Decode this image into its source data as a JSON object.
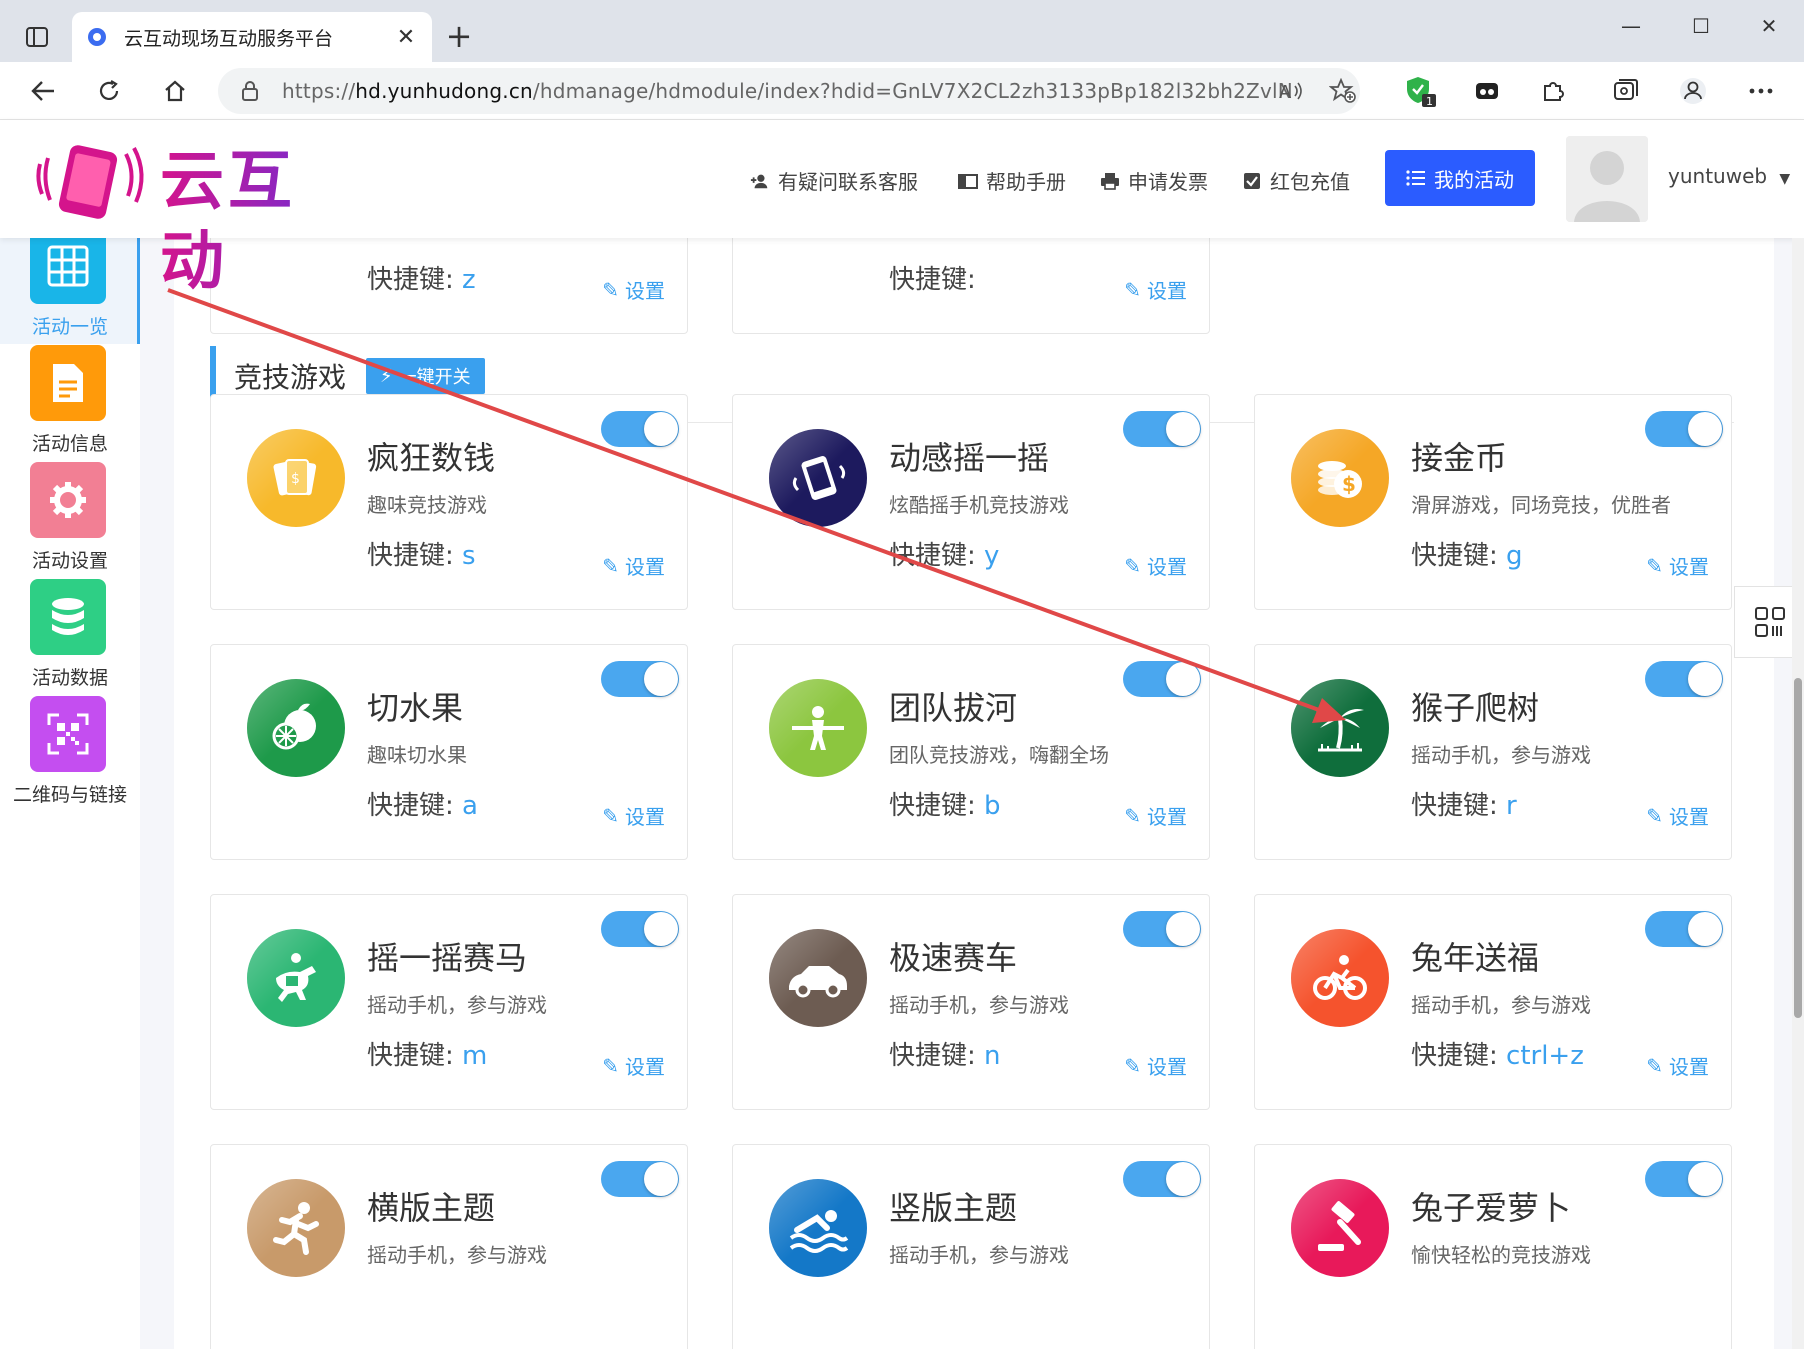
{
  "browser": {
    "tab_title": "云互动现场互动服务平台",
    "url_prefix": "https://",
    "url_host": "hd.yunhudong.cn",
    "url_path": "/hdmanage/hdmodule/index?hdid=GnLV7X2CL2zh3133pBp182l32bh2ZvlN",
    "extension_badge": "1"
  },
  "header": {
    "logo_text": "云互动",
    "links": {
      "support": "有疑问联系客服",
      "manual": "帮助手册",
      "invoice": "申请发票",
      "recharge": "红包充值"
    },
    "my_activity": "我的活动",
    "username": "yuntuweb"
  },
  "sidebar": {
    "items": [
      {
        "label": "活动一览",
        "color": "#19b5e8"
      },
      {
        "label": "活动信息",
        "color": "#ff9a0a"
      },
      {
        "label": "活动设置",
        "color": "#f27f94"
      },
      {
        "label": "活动数据",
        "color": "#2ecf85"
      },
      {
        "label": "二维码与链接",
        "color": "#c44ef0"
      }
    ]
  },
  "top_partial": {
    "key_label": "快捷键:",
    "card1_key": "z",
    "card2_key": "",
    "set_label": "设置"
  },
  "section": {
    "title": "竞技游戏",
    "one_key": "一键开关"
  },
  "labels": {
    "key": "快捷键:",
    "set": "设置"
  },
  "games": [
    {
      "title": "疯狂数钱",
      "desc": "趣味竞技游戏",
      "key": "s",
      "color": "#f7b92b",
      "icon": "money-cards-icon",
      "enabled": true
    },
    {
      "title": "动感摇一摇",
      "desc": "炫酷摇手机竞技游戏",
      "key": "y",
      "color": "#1d1a5e",
      "icon": "shake-phone-icon",
      "enabled": true
    },
    {
      "title": "接金币",
      "desc": "滑屏游戏，同场竞技，优胜者",
      "key": "g",
      "color": "#f5a726",
      "icon": "coins-icon",
      "enabled": true
    },
    {
      "title": "切水果",
      "desc": "趣味切水果",
      "key": "a",
      "color": "#1e9a4a",
      "icon": "fruit-icon",
      "enabled": true
    },
    {
      "title": "团队拔河",
      "desc": "团队竞技游戏，嗨翻全场",
      "key": "b",
      "color": "#8cc63f",
      "icon": "tug-of-war-icon",
      "enabled": true
    },
    {
      "title": "猴子爬树",
      "desc": "摇动手机，参与游戏",
      "key": "r",
      "color": "#0f6e3c",
      "icon": "palm-tree-icon",
      "enabled": true
    },
    {
      "title": "摇一摇赛马",
      "desc": "摇动手机，参与游戏",
      "key": "m",
      "color": "#2bb673",
      "icon": "horse-racing-icon",
      "enabled": true
    },
    {
      "title": "极速赛车",
      "desc": "摇动手机，参与游戏",
      "key": "n",
      "color": "#6d5c52",
      "icon": "car-icon",
      "enabled": true
    },
    {
      "title": "兔年送福",
      "desc": "摇动手机，参与游戏",
      "key": "ctrl+z",
      "color": "#f5532d",
      "icon": "bicycle-icon",
      "enabled": true
    },
    {
      "title": "横版主题",
      "desc": "摇动手机，参与游戏",
      "key": "",
      "color": "#c89a6a",
      "icon": "runner-icon",
      "enabled": true
    },
    {
      "title": "竖版主题",
      "desc": "摇动手机，参与游戏",
      "key": "",
      "color": "#1478c8",
      "icon": "swimmer-icon",
      "enabled": true
    },
    {
      "title": "兔子爱萝卜",
      "desc": "愉快轻松的竞技游戏",
      "key": "",
      "color": "#e8195a",
      "icon": "gavel-icon",
      "enabled": true
    }
  ]
}
